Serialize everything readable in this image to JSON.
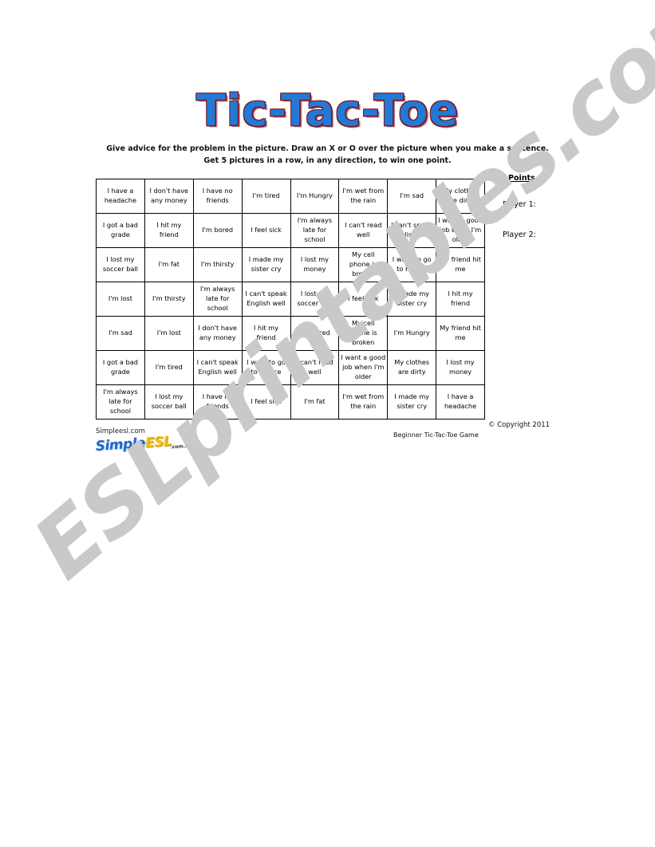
{
  "page": {
    "title": "Tic-Tac-Toe",
    "instructions": [
      "Give advice for the problem in the picture. Draw an X or O over the picture when you make a sentence.",
      "Get 5 pictures in a row, in any direction, to win one point."
    ]
  },
  "watermark": {
    "text": "ESLprintables.com"
  },
  "points": {
    "heading": "Points",
    "player1_label": "Player 1:",
    "player2_label": "Player 2:"
  },
  "footer": {
    "site_name": "Simpleesl.com",
    "logo_part1": "Simple",
    "logo_part2": "ESL",
    "logo_tld": ".com.tr",
    "copyright": "© Copyright 2011",
    "game_subtitle": "Beginner Tic-Tac-Toe Game"
  },
  "grid": {
    "rows": 7,
    "columns": 8,
    "cells": [
      [
        "I have a headache",
        "I don't have any money",
        "I have no friends",
        "I'm tired",
        "I'm Hungry",
        "I'm wet from the rain",
        "I'm sad",
        "My clothes are dirty"
      ],
      [
        "I got a bad grade",
        "I hit my friend",
        "I'm bored",
        "I feel sick",
        "I'm always late for school",
        "I can't read well",
        "I can't speak English well",
        "I want a good job when I'm older"
      ],
      [
        "I lost my soccer ball",
        "I'm fat",
        "I'm thirsty",
        "I made my sister cry",
        "I lost my money",
        "My cell phone is broken",
        "I want to go to France",
        "My friend hit me"
      ],
      [
        "I'm lost",
        "I'm thirsty",
        "I'm always late for school",
        "I can't speak English well",
        "I lost my soccer ball",
        "I feel sick",
        "I made my sister cry",
        "I hit my friend"
      ],
      [
        "I'm sad",
        "I'm lost",
        "I don't have any money",
        "I hit my friend",
        "I'm bored",
        "My cell phone is broken",
        "I'm Hungry",
        "My friend hit me"
      ],
      [
        "I got a bad grade",
        "I'm tired",
        "I can't speak English well",
        "I want to go to France",
        "I can't read well",
        "I want a good job when I'm older",
        "My clothes are dirty",
        "I lost my money"
      ],
      [
        "I'm always late for school",
        "I lost my soccer ball",
        "I have no friends",
        "I feel sick",
        "I'm fat",
        "I'm wet from the rain",
        "I made my sister cry",
        "I have a headache"
      ]
    ]
  }
}
